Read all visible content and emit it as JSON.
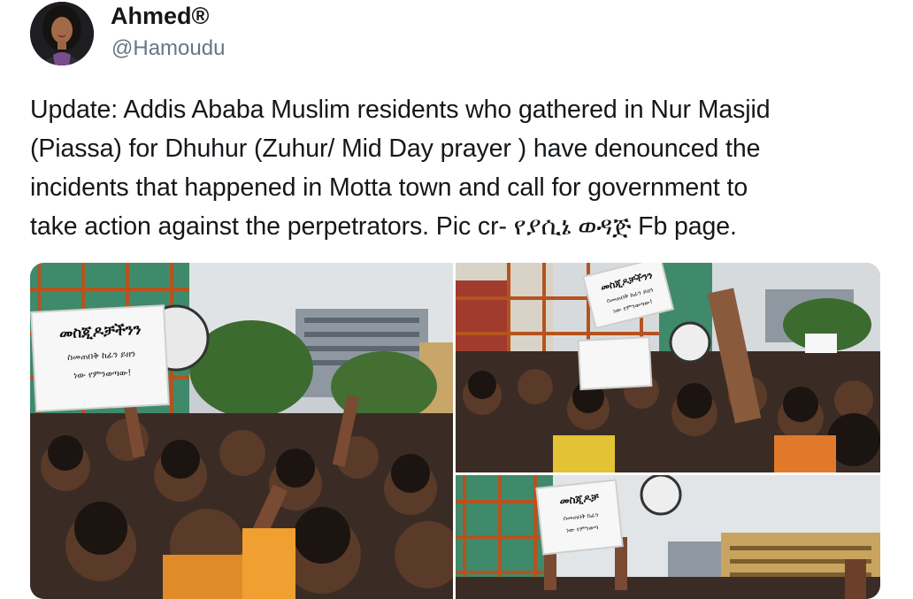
{
  "tweet": {
    "display_name": "Ahmed®",
    "handle": "@Hamoudu",
    "text_lines": [
      "Update:  Addis Ababa Muslim residents who gathered in Nur Masjid",
      "(Piassa) for Dhuhur (Zuhur/ Mid Day prayer ) have denounced the",
      "incidents that happened in Motta town and call for government to",
      "take action against the perpetrators. Pic cr- የያሲኔ ወዳጅ Fb page."
    ]
  },
  "media": {
    "photos": [
      {
        "sign_line_1": "መስጂዶቻችንን",
        "sign_line_2": "ስመጠበቅ ከፊን ይዘን",
        "sign_line_3": "ነው የምንወጣው!"
      },
      {
        "sign_line_1": "መስጂዶቻችንን",
        "sign_line_2": "ስመጠበቅ ከፊን ይዘን",
        "sign_line_3": "ነው የምንወጣው!"
      },
      {
        "sign_line_1": "መስጂዶቻ",
        "sign_line_2": "ስመጠበቅ ከፊን",
        "sign_line_3": "ነው የምንወጣ"
      }
    ]
  }
}
